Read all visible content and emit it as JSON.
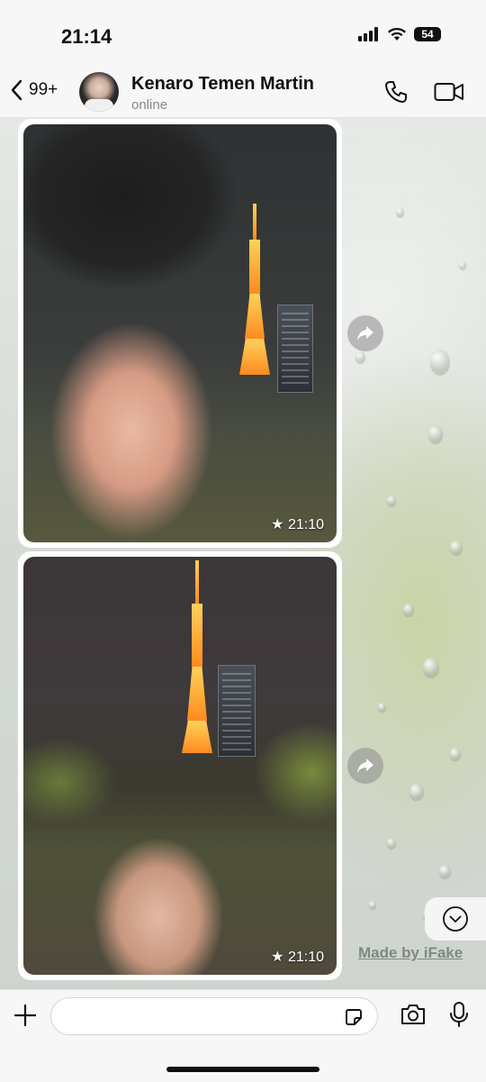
{
  "status_bar": {
    "time": "21:14",
    "battery": "54"
  },
  "header": {
    "back_count": "99+",
    "contact_name": "Kenaro Temen Martin",
    "contact_status": "online"
  },
  "messages": [
    {
      "type": "photo",
      "starred": true,
      "time": "★ 21:10"
    },
    {
      "type": "photo",
      "starred": true,
      "time": "★ 21:10"
    }
  ],
  "watermark": "Made by iFake",
  "composer": {
    "placeholder": ""
  },
  "icons": {
    "back": "chevron-left-icon",
    "call": "phone-icon",
    "video": "video-camera-icon",
    "forward": "forward-arrow-icon",
    "scroll_down": "chevron-down-icon",
    "plus": "plus-icon",
    "sticker": "sticker-icon",
    "camera": "camera-icon",
    "mic": "microphone-icon"
  },
  "colors": {
    "accent": "#111111",
    "bubble": "#ffffff",
    "muted": "#8a8a8a"
  }
}
